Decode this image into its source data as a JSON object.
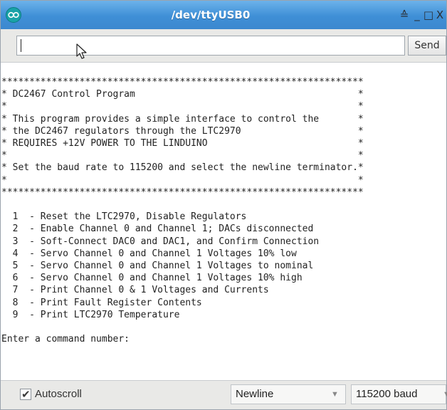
{
  "window": {
    "title": "/dev/ttyUSB0",
    "controls": {
      "eject": "≙",
      "minimize": "_",
      "maximize": "□",
      "close": "X"
    }
  },
  "toolbar": {
    "input_value": "",
    "send_label": "Send"
  },
  "output": {
    "lines": [
      "*****************************************************************",
      "* DC2467 Control Program                                        *",
      "*                                                               *",
      "* This program provides a simple interface to control the       *",
      "* the DC2467 regulators through the LTC2970                     *",
      "* REQUIRES +12V POWER TO THE LINDUINO                           *",
      "*                                                               *",
      "* Set the baud rate to 115200 and select the newline terminator.*",
      "*                                                               *",
      "*****************************************************************",
      "",
      "  1  - Reset the LTC2970, Disable Regulators",
      "  2  - Enable Channel 0 and Channel 1; DACs disconnected",
      "  3  - Soft-Connect DAC0 and DAC1, and Confirm Connection",
      "  4  - Servo Channel 0 and Channel 1 Voltages 10% low",
      "  5  - Servo Channel 0 and Channel 1 Voltages to nominal",
      "  6  - Servo Channel 0 and Channel 1 Voltages 10% high",
      "  7  - Print Channel 0 & 1 Voltages and Currents",
      "  8  - Print Fault Register Contents",
      "  9  - Print LTC2970 Temperature",
      "",
      "Enter a command number:"
    ]
  },
  "bottom_bar": {
    "autoscroll_label": "Autoscroll",
    "autoscroll_checked": true,
    "line_ending": "Newline",
    "baud_rate": "115200 baud"
  },
  "icons": {
    "app": "arduino-icon",
    "pointer": "mouse-pointer-icon",
    "dropdown": "chevron-down-icon"
  },
  "colors": {
    "titlebar": "#3f8fd6",
    "app_icon": "#19a3a8"
  }
}
